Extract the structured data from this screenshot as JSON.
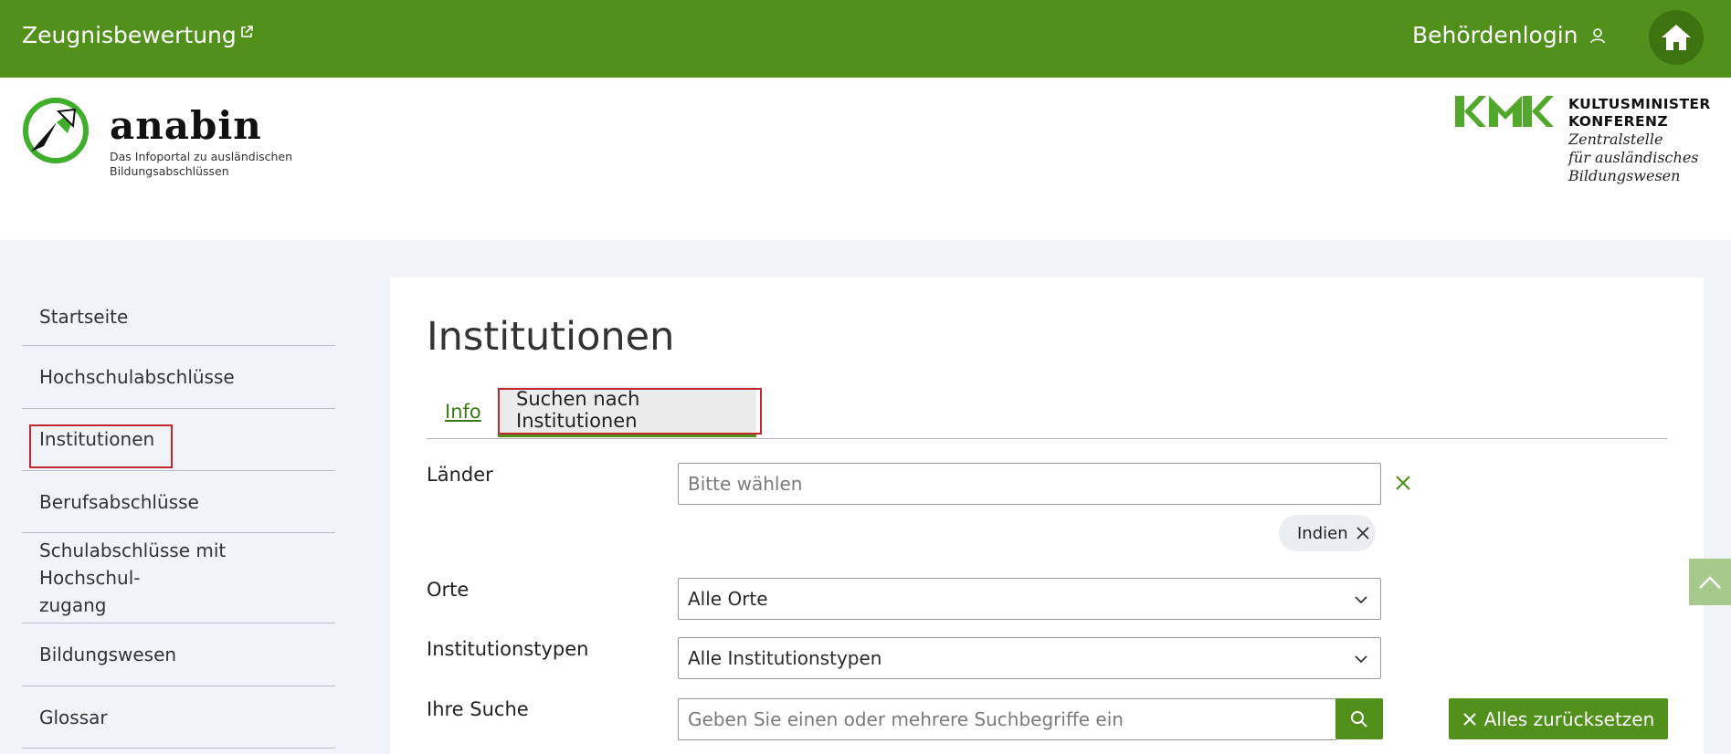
{
  "topbar": {
    "left_link": "Zeugnisbewertung",
    "login": "Behördenlogin"
  },
  "header": {
    "brand_name": "anabin",
    "brand_sub": "Das Infoportal zu ausländischen Bildungsabschlüssen",
    "kmk_line1": "KULTUSMINISTER",
    "kmk_line2": "KONFERENZ",
    "kmk_line3": "Zentralstelle",
    "kmk_line4": "für ausländisches",
    "kmk_line5": "Bildungswesen"
  },
  "sidebar": {
    "items": [
      {
        "label": "Startseite"
      },
      {
        "label": "Hochschulabschlüsse"
      },
      {
        "label": "Institutionen"
      },
      {
        "label": "Berufsabschlüsse"
      },
      {
        "label": "Schulabschlüsse mit Hochschul-"
      },
      {
        "label": "Bildungswesen"
      },
      {
        "label": "Glossar"
      }
    ],
    "item5_line2": "zugang"
  },
  "main": {
    "title": "Institutionen",
    "tabs": [
      {
        "label": "Info"
      },
      {
        "label": "Suchen nach Institutionen"
      }
    ],
    "form": {
      "laender_label": "Länder",
      "laender_placeholder": "Bitte wählen",
      "laender_chip": "Indien",
      "orte_label": "Orte",
      "orte_value": "Alle Orte",
      "typen_label": "Institutionstypen",
      "typen_value": "Alle Institutionstypen",
      "suche_label": "Ihre Suche",
      "suche_placeholder": "Geben Sie einen oder mehrere Suchbegriffe ein",
      "reset_label": "Alles zurücksetzen"
    }
  },
  "colors": {
    "brand_green": "#52901c",
    "highlight_red": "#c0262d"
  }
}
